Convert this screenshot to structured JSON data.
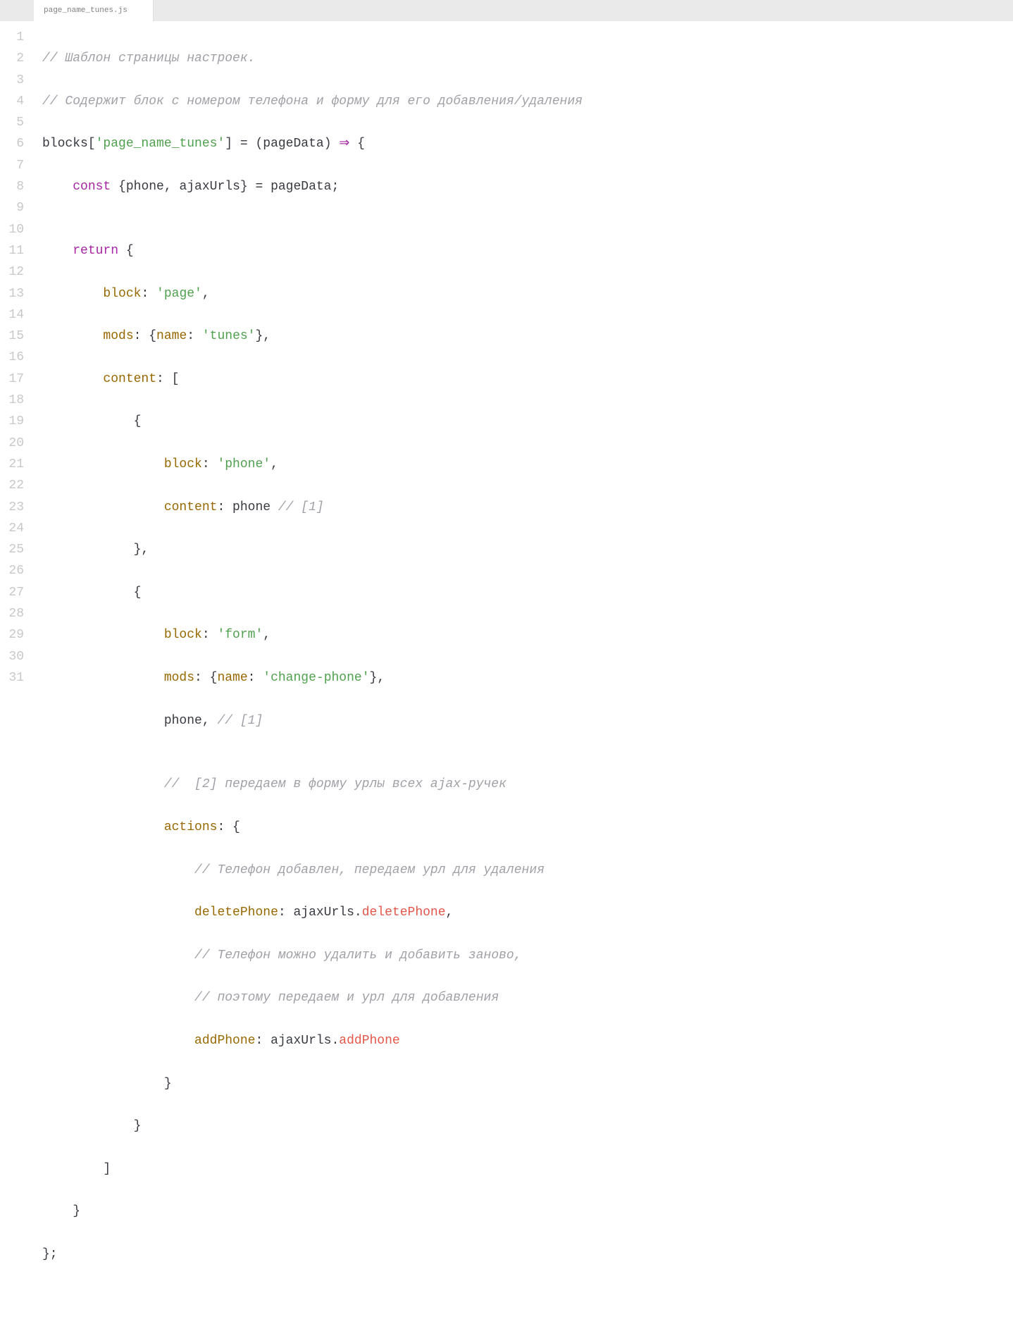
{
  "tab": {
    "filename": "page_name_tunes.js"
  },
  "gutter": {
    "lines": [
      "1",
      "2",
      "3",
      "4",
      "5",
      "6",
      "7",
      "8",
      "9",
      "10",
      "11",
      "12",
      "13",
      "14",
      "15",
      "16",
      "17",
      "18",
      "19",
      "20",
      "21",
      "22",
      "23",
      "24",
      "25",
      "26",
      "27",
      "28",
      "29",
      "30",
      "31"
    ]
  },
  "code": {
    "line1_comment": "// Шаблон страницы настроек.",
    "line2_comment": "// Содержит блок с номером телефона и форму для его добавления/удаления",
    "l3_blocks": "blocks[",
    "l3_str": "'page_name_tunes'",
    "l3_rest1": "] = (pageData) ",
    "l3_arrow": "⇒",
    "l3_rest2": " {",
    "l4_indent": "    ",
    "l4_const": "const",
    "l4_mid": " {phone, ajaxUrls} = pageData;",
    "l5": "",
    "l6_indent": "    ",
    "l6_return": "return",
    "l6_brace": " {",
    "l7_indent": "        ",
    "l7_key": "block",
    "l7_colon": ": ",
    "l7_val": "'page'",
    "l7_comma": ",",
    "l8_indent": "        ",
    "l8_key": "mods",
    "l8_colon": ": {",
    "l8_key2": "name",
    "l8_colon2": ": ",
    "l8_val": "'tunes'",
    "l8_end": "},",
    "l9_indent": "        ",
    "l9_key": "content",
    "l9_colon": ": [",
    "l10": "            {",
    "l11_indent": "                ",
    "l11_key": "block",
    "l11_colon": ": ",
    "l11_val": "'phone'",
    "l11_comma": ",",
    "l12_indent": "                ",
    "l12_key": "content",
    "l12_colon": ": phone ",
    "l12_comment": "// [1]",
    "l13": "            },",
    "l14": "            {",
    "l15_indent": "                ",
    "l15_key": "block",
    "l15_colon": ": ",
    "l15_val": "'form'",
    "l15_comma": ",",
    "l16_indent": "                ",
    "l16_key": "mods",
    "l16_colon": ": {",
    "l16_key2": "name",
    "l16_colon2": ": ",
    "l16_val": "'change-phone'",
    "l16_end": "},",
    "l17_indent": "                phone, ",
    "l17_comment": "// [1]",
    "l18": "",
    "l19_indent": "                ",
    "l19_comment": "//  [2] передаем в форму урлы всех ajax-ручек",
    "l20_indent": "                ",
    "l20_key": "actions",
    "l20_colon": ": {",
    "l21_indent": "                    ",
    "l21_comment": "// Телефон добавлен, передаем урл для удаления",
    "l22_indent": "                    ",
    "l22_key": "deletePhone",
    "l22_colon": ": ajaxUrls.",
    "l22_attr": "deletePhone",
    "l22_comma": ",",
    "l23_indent": "                    ",
    "l23_comment": "// Телефон можно удалить и добавить заново,",
    "l24_indent": "                    ",
    "l24_comment": "// поэтому передаем и урл для добавления",
    "l25_indent": "                    ",
    "l25_key": "addPhone",
    "l25_colon": ": ajaxUrls.",
    "l25_attr": "addPhone",
    "l26": "                }",
    "l27": "            }",
    "l28": "        ]",
    "l29": "    }",
    "l30": "};",
    "l31": ""
  }
}
